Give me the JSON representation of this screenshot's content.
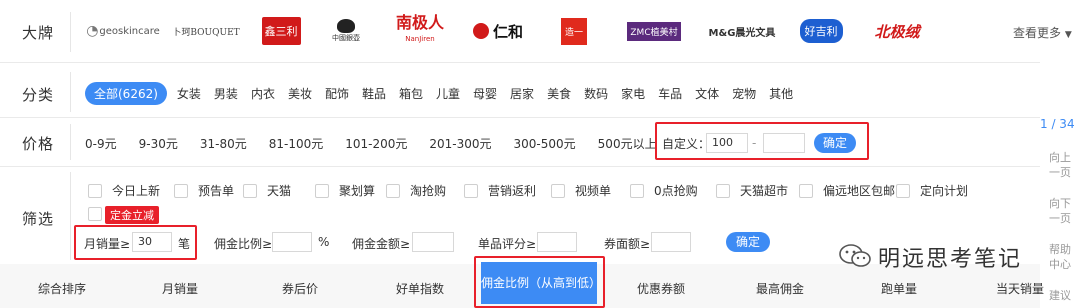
{
  "brand_row": {
    "label": "大牌",
    "brands": [
      {
        "text": "geoskincare",
        "color": "#555555",
        "size": 10
      },
      {
        "text": "卜珂BOUQUET",
        "color": "#444444",
        "size": 9
      },
      {
        "text": "鑫三利",
        "color": "#d11a1a",
        "size": 12
      },
      {
        "text": "中國銀壺",
        "color": "#333333",
        "size": 9
      },
      {
        "text": "南极人",
        "color": "#d11a1a",
        "size": 17
      },
      {
        "text": "仁和",
        "color": "#111111",
        "size": 16
      },
      {
        "text": "造一",
        "color": "#ffffff",
        "size": 10
      },
      {
        "text": "ZMC植美村",
        "color": "#ffffff",
        "size": 10
      },
      {
        "text": "M&G晨光文具",
        "color": "#333333",
        "size": 10
      },
      {
        "text": "好吉利",
        "color": "#ffffff",
        "size": 11
      },
      {
        "text": "北极绒",
        "color": "#d11a1a",
        "size": 16
      }
    ],
    "more_label": "查看更多"
  },
  "category_row": {
    "label": "分类",
    "items": [
      "全部(6262)",
      "女装",
      "男装",
      "内衣",
      "美妆",
      "配饰",
      "鞋品",
      "箱包",
      "儿童",
      "母婴",
      "居家",
      "美食",
      "数码",
      "家电",
      "车品",
      "文体",
      "宠物",
      "其他"
    ]
  },
  "price_row": {
    "label": "价格",
    "ranges": [
      "0-9元",
      "9-30元",
      "31-80元",
      "81-100元",
      "101-200元",
      "201-300元",
      "300-500元",
      "500元以上"
    ],
    "custom_label": "自定义：",
    "min_value": "100",
    "range_separator": "-",
    "max_value": "",
    "confirm_label": "确定"
  },
  "pager": {
    "text": "1 / 34"
  },
  "filter_row": {
    "label": "筛选",
    "checkboxes": [
      "今日上新",
      "预告单",
      "天猫",
      "聚划算",
      "淘抢购",
      "营销返利",
      "视频单",
      "0点抢购",
      "天猫超市",
      "偏远地区包邮",
      "定向计划"
    ],
    "tag": "定金立减",
    "monthly_sales_label": "月销量≥",
    "monthly_sales_value": "30",
    "monthly_sales_unit": "笔",
    "commission_rate_label": "佣金比例≥",
    "commission_rate_unit": "%",
    "commission_amount_label": "佣金金额≥",
    "rating_label": "单品评分≥",
    "coupon_label": "券面额≥",
    "confirm_label": "确定"
  },
  "sort_bar": {
    "items": [
      "综合排序",
      "月销量",
      "券后价",
      "好单指数",
      "佣金比例（从高到低）",
      "优惠券额",
      "最高佣金",
      "跑单量",
      "当天销量"
    ],
    "active_index": 4
  },
  "side_nav": {
    "prev": [
      "向上",
      "一页"
    ],
    "next": [
      "向下",
      "一页"
    ],
    "help": [
      "帮助",
      "中心"
    ],
    "suggest": [
      "建议"
    ]
  },
  "watermark": {
    "text": "明远思考笔记"
  },
  "colors": {
    "accent": "#3d8bf4",
    "highlight": "#e8202a"
  }
}
